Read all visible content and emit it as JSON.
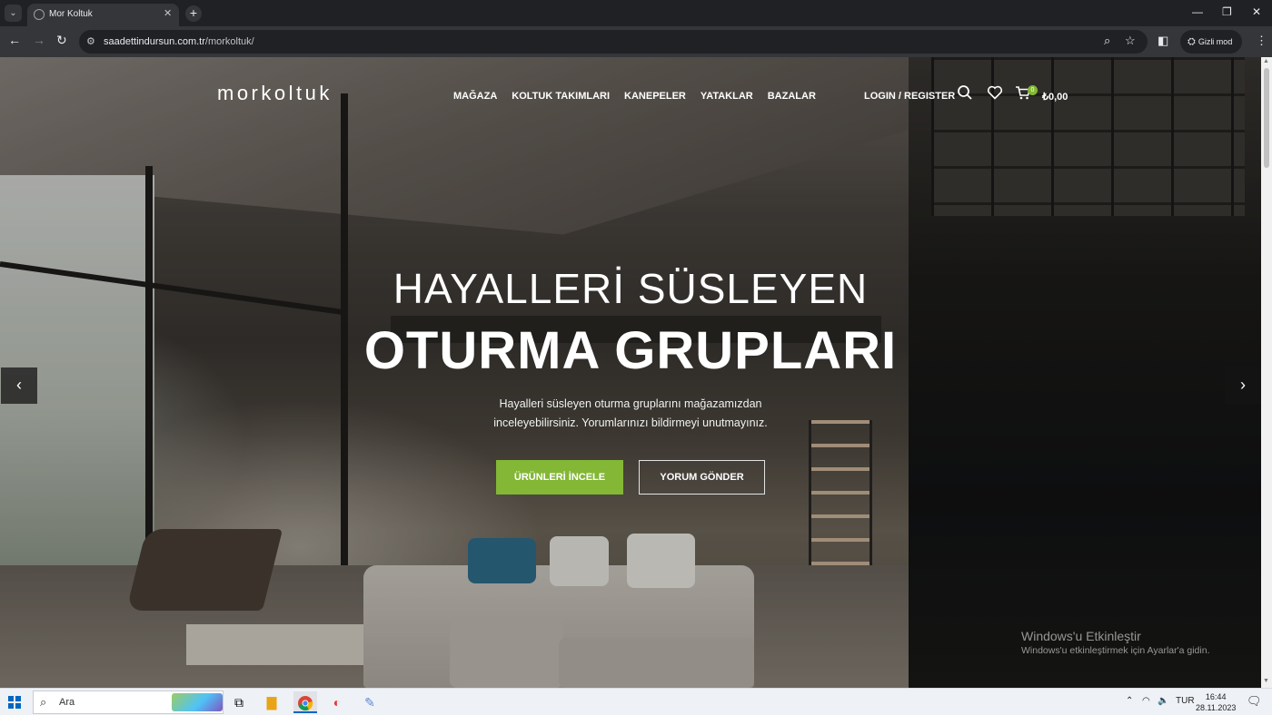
{
  "browser": {
    "tab_title": "Mor Koltuk",
    "url_host": "saadettindursun.com.tr",
    "url_path": "/morkoltuk/",
    "incognito_label": "Gizli mod"
  },
  "site": {
    "logo": "morkoltuk",
    "nav": [
      "MAĞAZA",
      "KOLTUK TAKIMLARI",
      "KANEPELER",
      "YATAKLAR",
      "BAZALAR"
    ],
    "login_label": "LOGIN / REGISTER",
    "cart_count": "0",
    "cart_total": "₺0,00"
  },
  "hero": {
    "subtitle": "HAYALLERİ SÜSLEYEN",
    "title": "OTURMA GRUPLARI",
    "description_line1": "Hayalleri süsleyen oturma gruplarını mağazamızdan",
    "description_line2": "inceleyebilirsiniz. Yorumlarınızı bildirmeyi unutmayınız.",
    "primary_button": "ÜRÜNLERİ İNCELE",
    "secondary_button": "YORUM GÖNDER",
    "prev_arrow": "‹",
    "next_arrow": "›"
  },
  "watermark": {
    "line1": "Windows'u Etkinleştir",
    "line2": "Windows'u etkinleştirmek için Ayarlar'a gidin."
  },
  "taskbar": {
    "search_placeholder": "Ara",
    "lang": "TUR",
    "time": "16:44",
    "date": "28.11.2023"
  },
  "colors": {
    "accent": "#83b735",
    "chrome_dark": "#202124",
    "chrome_mid": "#35363a"
  }
}
